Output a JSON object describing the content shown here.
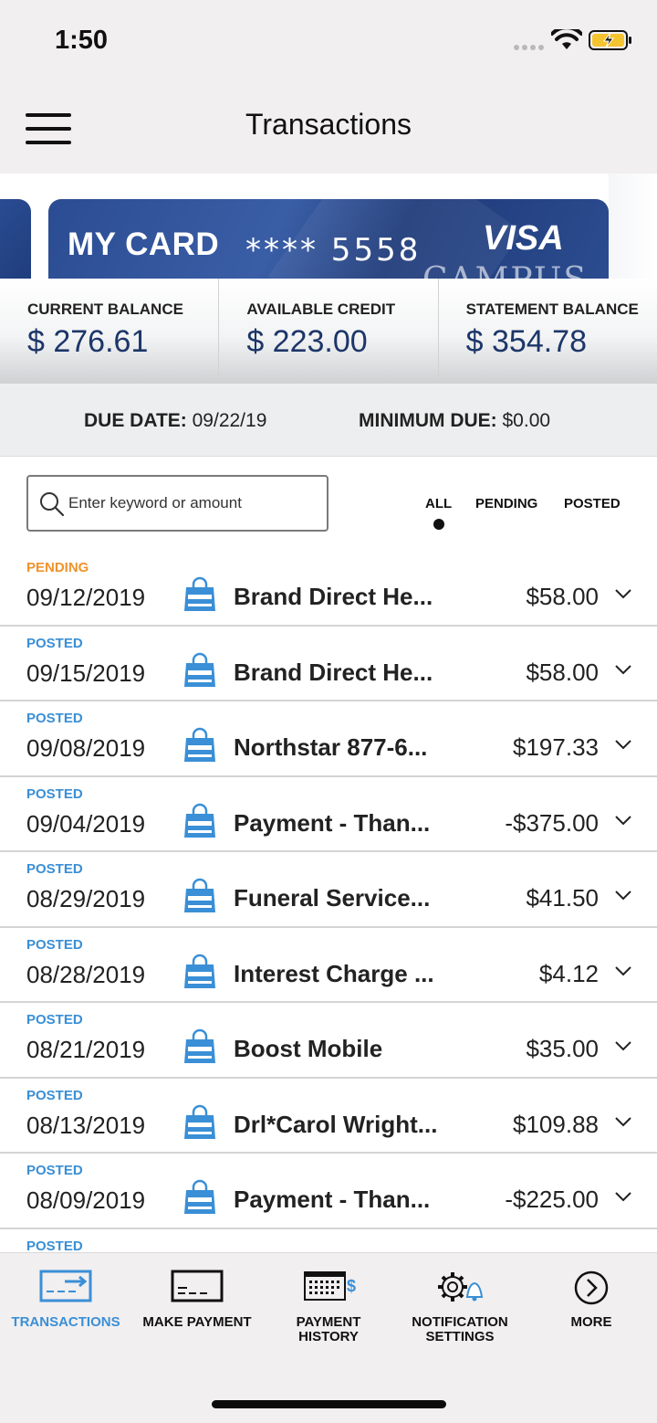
{
  "status_bar": {
    "time": "1:50"
  },
  "nav": {
    "title": "Transactions"
  },
  "card": {
    "name": "MY CARD",
    "number": "**** 5558",
    "brand": "VISA",
    "issuer_partial": "CAMPUS"
  },
  "balances": [
    {
      "label": "CURRENT BALANCE",
      "value": "$ 276.61"
    },
    {
      "label": "AVAILABLE CREDIT",
      "value": "$ 223.00"
    },
    {
      "label": "STATEMENT BALANCE",
      "value": "$ 354.78"
    }
  ],
  "due": {
    "due_date_label": "DUE DATE:",
    "due_date_value": "09/22/19",
    "min_due_label": "MINIMUM DUE:",
    "min_due_value": "$0.00"
  },
  "search": {
    "placeholder": "Enter keyword or amount"
  },
  "filters": {
    "all": "ALL",
    "pending": "PENDING",
    "posted": "POSTED",
    "selected": "ALL"
  },
  "transactions": [
    {
      "status": "PENDING",
      "date": "09/12/2019",
      "merchant": "Brand Direct He...",
      "amount": "$58.00"
    },
    {
      "status": "POSTED",
      "date": "09/15/2019",
      "merchant": "Brand Direct He...",
      "amount": "$58.00"
    },
    {
      "status": "POSTED",
      "date": "09/08/2019",
      "merchant": "Northstar 877-6...",
      "amount": "$197.33"
    },
    {
      "status": "POSTED",
      "date": "09/04/2019",
      "merchant": "Payment - Than...",
      "amount": "-$375.00"
    },
    {
      "status": "POSTED",
      "date": "08/29/2019",
      "merchant": "Funeral Service...",
      "amount": "$41.50"
    },
    {
      "status": "POSTED",
      "date": "08/28/2019",
      "merchant": "Interest Charge ...",
      "amount": "$4.12"
    },
    {
      "status": "POSTED",
      "date": "08/21/2019",
      "merchant": "Boost Mobile",
      "amount": "$35.00"
    },
    {
      "status": "POSTED",
      "date": "08/13/2019",
      "merchant": "Drl*Carol Wright...",
      "amount": "$109.88"
    },
    {
      "status": "POSTED",
      "date": "08/09/2019",
      "merchant": "Payment - Than...",
      "amount": "-$225.00"
    },
    {
      "status": "POSTED"
    }
  ],
  "tab_bar": {
    "transactions": "TRANSACTIONS",
    "make_payment": "MAKE PAYMENT",
    "payment_history_1": "PAYMENT",
    "payment_history_2": "HISTORY",
    "notification_settings_1": "NOTIFICATION",
    "notification_settings_2": "SETTINGS",
    "more": "MORE"
  },
  "colors": {
    "accent": "#3a8fd6",
    "pending": "#f0932c",
    "balance_text": "#1c3669",
    "card": "#2b4c92"
  },
  "icons": [
    "hamburger-icon",
    "search-icon",
    "shopping-bag-icon",
    "chevron-down-icon",
    "card-arrow-icon",
    "card-icon",
    "calendar-dollar-icon",
    "gear-bell-icon",
    "chevron-right-circle-icon"
  ]
}
